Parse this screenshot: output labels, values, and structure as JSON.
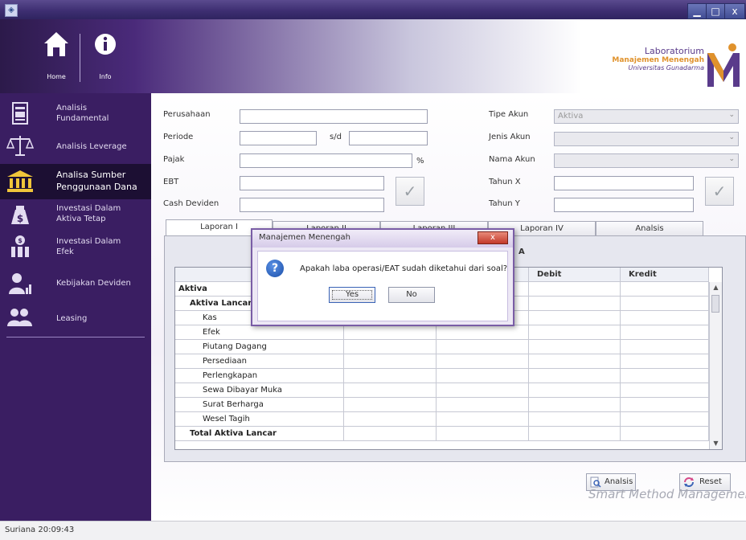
{
  "window": {
    "min_glyph": "▁",
    "max_glyph": "□",
    "close_glyph": "x"
  },
  "header": {
    "home_label": "Home",
    "info_label": "Info",
    "lab_line1": "Laboratorium",
    "lab_line2": "Manajemen Menengah",
    "lab_line3": "Universitas Gunadarma",
    "brand_color": "#5a3b8b",
    "accent_color": "#e0922c"
  },
  "sidebar": {
    "items": [
      {
        "label": "Analisis\nFundamental",
        "icon": "document-icon"
      },
      {
        "label": "Analisis Leverage",
        "icon": "balance-scale-icon"
      },
      {
        "label": "Analisa Sumber\nPenggunaan Dana",
        "icon": "bank-icon"
      },
      {
        "label": "Investasi Dalam\nAktiva Tetap",
        "icon": "money-bag-icon"
      },
      {
        "label": "Investasi Dalam\nEfek",
        "icon": "investor-icon"
      },
      {
        "label": "Kebijakan Deviden",
        "icon": "dividend-icon"
      },
      {
        "label": "Leasing",
        "icon": "people-icon"
      }
    ],
    "bg_color": "#3a1e62"
  },
  "form": {
    "perusahaan_label": "Perusahaan",
    "periode_label": "Periode",
    "sd_label": "s/d",
    "pajak_label": "Pajak",
    "percent_label": "%",
    "ebt_label": "EBT",
    "cash_deviden_label": "Cash Deviden",
    "tipe_akun_label": "Tipe Akun",
    "tipe_akun_value": "Aktiva",
    "jenis_akun_label": "Jenis Akun",
    "nama_akun_label": "Nama Akun",
    "tahun_x_label": "Tahun X",
    "tahun_y_label": "Tahun Y",
    "check_glyph": "✓"
  },
  "tabs": [
    "Laporan I",
    "Laporan II",
    "Laporan III",
    "Laporan IV",
    "Analsis"
  ],
  "table": {
    "subheader": "A",
    "headers": [
      "",
      "",
      "",
      "Debit",
      "Kredit"
    ],
    "rows": [
      {
        "label": "Aktiva",
        "style": "bold",
        "indent": 0
      },
      {
        "label": "Aktiva Lancar",
        "style": "bold",
        "indent": 1
      },
      {
        "label": "Kas",
        "style": "normal",
        "indent": 2
      },
      {
        "label": "Efek",
        "style": "normal",
        "indent": 2
      },
      {
        "label": "Piutang Dagang",
        "style": "normal",
        "indent": 2
      },
      {
        "label": "Persediaan",
        "style": "normal",
        "indent": 2
      },
      {
        "label": "Perlengkapan",
        "style": "normal",
        "indent": 2
      },
      {
        "label": "Sewa Dibayar Muka",
        "style": "normal",
        "indent": 2
      },
      {
        "label": "Surat Berharga",
        "style": "normal",
        "indent": 2
      },
      {
        "label": "Wesel Tagih",
        "style": "normal",
        "indent": 2
      },
      {
        "label": "Total Aktiva Lancar",
        "style": "bold",
        "indent": 1
      }
    ]
  },
  "buttons": {
    "analisis": "Analsis",
    "reset": "Reset"
  },
  "watermark": "Smart Method Management",
  "dialog": {
    "title": "Manajemen Menengah",
    "close_glyph": "x",
    "question_glyph": "?",
    "message": "Apakah laba operasi/EAT sudah diketahui dari soal?",
    "yes_label": "Yes",
    "no_label": "No"
  },
  "status": {
    "text": "Suriana  20:09:43"
  }
}
